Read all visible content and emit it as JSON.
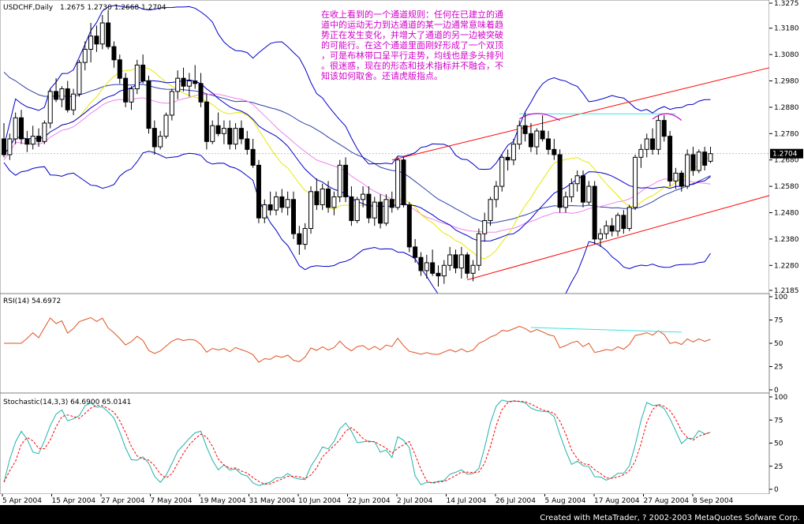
{
  "chart_data": {
    "type": "candlestick",
    "symbol_label": "USDCHF,Daily",
    "ohlc_label": "1.2675 1.2730 1.2668 1.2704",
    "current_price": "1.2704",
    "price_axis": {
      "range": [
        1.2185,
        1.3275
      ],
      "ticks": [
        "1.3275",
        "1.3180",
        "1.3080",
        "1.2980",
        "1.2880",
        "1.2780",
        "1.2680",
        "1.2580",
        "1.2480",
        "1.2380",
        "1.2280",
        "1.2185"
      ]
    },
    "x_axis": {
      "ticks": [
        "5 Apr 2004",
        "15 Apr 2004",
        "27 Apr 2004",
        "7 May 2004",
        "19 May 2004",
        "31 May 2004",
        "10 Jun 2004",
        "22 Jun 2004",
        "2 Jul 2004",
        "14 Jul 2004",
        "26 Jul 2004",
        "5 Aug 2004",
        "17 Aug 2004",
        "27 Aug 2004",
        "8 Sep 2004"
      ]
    },
    "candles": [
      [
        1.276,
        1.282,
        1.269,
        1.27
      ],
      [
        1.27,
        1.278,
        1.268,
        1.276
      ],
      [
        1.276,
        1.286,
        1.274,
        1.284
      ],
      [
        1.284,
        1.287,
        1.274,
        1.276
      ],
      [
        1.276,
        1.279,
        1.271,
        1.274
      ],
      [
        1.274,
        1.281,
        1.272,
        1.277
      ],
      [
        1.277,
        1.28,
        1.273,
        1.275
      ],
      [
        1.275,
        1.283,
        1.274,
        1.282
      ],
      [
        1.282,
        1.295,
        1.28,
        1.294
      ],
      [
        1.294,
        1.299,
        1.29,
        1.291
      ],
      [
        1.291,
        1.296,
        1.288,
        1.295
      ],
      [
        1.295,
        1.298,
        1.286,
        1.287
      ],
      [
        1.287,
        1.295,
        1.285,
        1.293
      ],
      [
        1.293,
        1.306,
        1.292,
        1.305
      ],
      [
        1.305,
        1.313,
        1.302,
        1.31
      ],
      [
        1.31,
        1.32,
        1.305,
        1.315
      ],
      [
        1.315,
        1.319,
        1.309,
        1.312
      ],
      [
        1.312,
        1.323,
        1.31,
        1.32
      ],
      [
        1.32,
        1.325,
        1.31,
        1.311
      ],
      [
        1.311,
        1.313,
        1.303,
        1.306
      ],
      [
        1.306,
        1.308,
        1.297,
        1.299
      ],
      [
        1.299,
        1.301,
        1.288,
        1.29
      ],
      [
        1.29,
        1.296,
        1.287,
        1.295
      ],
      [
        1.295,
        1.306,
        1.293,
        1.304
      ],
      [
        1.304,
        1.308,
        1.297,
        1.298
      ],
      [
        1.298,
        1.3,
        1.278,
        1.28
      ],
      [
        1.28,
        1.283,
        1.27,
        1.273
      ],
      [
        1.273,
        1.279,
        1.272,
        1.277
      ],
      [
        1.277,
        1.286,
        1.276,
        1.285
      ],
      [
        1.285,
        1.295,
        1.283,
        1.294
      ],
      [
        1.294,
        1.302,
        1.291,
        1.299
      ],
      [
        1.299,
        1.303,
        1.294,
        1.296
      ],
      [
        1.296,
        1.301,
        1.292,
        1.298
      ],
      [
        1.298,
        1.304,
        1.295,
        1.297
      ],
      [
        1.297,
        1.301,
        1.288,
        1.29
      ],
      [
        1.29,
        1.293,
        1.272,
        1.275
      ],
      [
        1.275,
        1.283,
        1.274,
        1.281
      ],
      [
        1.281,
        1.286,
        1.277,
        1.278
      ],
      [
        1.278,
        1.283,
        1.274,
        1.28
      ],
      [
        1.28,
        1.283,
        1.272,
        1.274
      ],
      [
        1.274,
        1.282,
        1.272,
        1.28
      ],
      [
        1.28,
        1.283,
        1.274,
        1.276
      ],
      [
        1.276,
        1.279,
        1.27,
        1.272
      ],
      [
        1.272,
        1.276,
        1.265,
        1.266
      ],
      [
        1.266,
        1.268,
        1.244,
        1.246
      ],
      [
        1.246,
        1.253,
        1.244,
        1.251
      ],
      [
        1.251,
        1.256,
        1.247,
        1.249
      ],
      [
        1.249,
        1.256,
        1.247,
        1.254
      ],
      [
        1.254,
        1.257,
        1.248,
        1.25
      ],
      [
        1.25,
        1.256,
        1.247,
        1.253
      ],
      [
        1.253,
        1.256,
        1.238,
        1.24
      ],
      [
        1.24,
        1.243,
        1.232,
        1.236
      ],
      [
        1.236,
        1.244,
        1.234,
        1.242
      ],
      [
        1.242,
        1.258,
        1.24,
        1.256
      ],
      [
        1.256,
        1.261,
        1.249,
        1.251
      ],
      [
        1.251,
        1.259,
        1.249,
        1.257
      ],
      [
        1.257,
        1.26,
        1.248,
        1.25
      ],
      [
        1.25,
        1.256,
        1.247,
        1.254
      ],
      [
        1.254,
        1.268,
        1.252,
        1.266
      ],
      [
        1.266,
        1.269,
        1.252,
        1.254
      ],
      [
        1.254,
        1.258,
        1.243,
        1.245
      ],
      [
        1.245,
        1.254,
        1.244,
        1.253
      ],
      [
        1.253,
        1.258,
        1.25,
        1.255
      ],
      [
        1.255,
        1.258,
        1.244,
        1.246
      ],
      [
        1.246,
        1.254,
        1.243,
        1.252
      ],
      [
        1.252,
        1.255,
        1.242,
        1.244
      ],
      [
        1.244,
        1.255,
        1.243,
        1.253
      ],
      [
        1.253,
        1.256,
        1.248,
        1.25
      ],
      [
        1.25,
        1.269,
        1.249,
        1.268
      ],
      [
        1.268,
        1.269,
        1.25,
        1.251
      ],
      [
        1.251,
        1.252,
        1.233,
        1.235
      ],
      [
        1.235,
        1.238,
        1.229,
        1.231
      ],
      [
        1.231,
        1.233,
        1.224,
        1.226
      ],
      [
        1.226,
        1.232,
        1.223,
        1.229
      ],
      [
        1.229,
        1.234,
        1.224,
        1.225
      ],
      [
        1.225,
        1.228,
        1.22,
        1.224
      ],
      [
        1.224,
        1.23,
        1.221,
        1.228
      ],
      [
        1.228,
        1.235,
        1.226,
        1.232
      ],
      [
        1.232,
        1.234,
        1.225,
        1.227
      ],
      [
        1.227,
        1.235,
        1.223,
        1.232
      ],
      [
        1.232,
        1.233,
        1.223,
        1.225
      ],
      [
        1.225,
        1.23,
        1.222,
        1.228
      ],
      [
        1.228,
        1.242,
        1.226,
        1.24
      ],
      [
        1.24,
        1.248,
        1.237,
        1.245
      ],
      [
        1.245,
        1.254,
        1.243,
        1.253
      ],
      [
        1.253,
        1.26,
        1.25,
        1.258
      ],
      [
        1.258,
        1.27,
        1.256,
        1.269
      ],
      [
        1.269,
        1.272,
        1.264,
        1.268
      ],
      [
        1.268,
        1.276,
        1.266,
        1.274
      ],
      [
        1.274,
        1.283,
        1.272,
        1.281
      ],
      [
        1.281,
        1.286,
        1.275,
        1.278
      ],
      [
        1.278,
        1.282,
        1.271,
        1.273
      ],
      [
        1.273,
        1.28,
        1.27,
        1.279
      ],
      [
        1.279,
        1.285,
        1.275,
        1.276
      ],
      [
        1.276,
        1.279,
        1.27,
        1.272
      ],
      [
        1.272,
        1.276,
        1.268,
        1.27
      ],
      [
        1.27,
        1.272,
        1.248,
        1.25
      ],
      [
        1.25,
        1.256,
        1.248,
        1.254
      ],
      [
        1.254,
        1.261,
        1.252,
        1.259
      ],
      [
        1.259,
        1.264,
        1.256,
        1.262
      ],
      [
        1.262,
        1.264,
        1.25,
        1.252
      ],
      [
        1.252,
        1.26,
        1.251,
        1.258
      ],
      [
        1.258,
        1.26,
        1.236,
        1.238
      ],
      [
        1.238,
        1.242,
        1.235,
        1.24
      ],
      [
        1.24,
        1.245,
        1.238,
        1.243
      ],
      [
        1.243,
        1.246,
        1.239,
        1.241
      ],
      [
        1.241,
        1.248,
        1.239,
        1.247
      ],
      [
        1.247,
        1.249,
        1.24,
        1.242
      ],
      [
        1.242,
        1.251,
        1.241,
        1.25
      ],
      [
        1.25,
        1.27,
        1.249,
        1.269
      ],
      [
        1.269,
        1.274,
        1.265,
        1.272
      ],
      [
        1.272,
        1.278,
        1.269,
        1.276
      ],
      [
        1.276,
        1.28,
        1.27,
        1.272
      ],
      [
        1.272,
        1.285,
        1.27,
        1.283
      ],
      [
        1.283,
        1.285,
        1.275,
        1.277
      ],
      [
        1.277,
        1.279,
        1.258,
        1.26
      ],
      [
        1.26,
        1.265,
        1.257,
        1.263
      ],
      [
        1.263,
        1.264,
        1.256,
        1.258
      ],
      [
        1.258,
        1.272,
        1.257,
        1.27
      ],
      [
        1.27,
        1.273,
        1.262,
        1.264
      ],
      [
        1.264,
        1.272,
        1.263,
        1.271
      ],
      [
        1.271,
        1.273,
        1.264,
        1.266
      ],
      [
        1.2675,
        1.273,
        1.2668,
        1.2704
      ]
    ],
    "indicators": {
      "bollinger": "Bollinger Bands (blue)",
      "moving_averages": [
        "Yellow MA",
        "Violet MA",
        "Dark blue MA"
      ],
      "channel_lines": "Red upward channel",
      "double_top_marker": "Magenta arcs with cyan neckline"
    },
    "rsi": {
      "label": "RSI(14) 54.6972",
      "ticks": [
        "100",
        "75",
        "50",
        "25",
        "0"
      ]
    },
    "stochastic": {
      "label": "Stochastic(14,3,3) 64.6900 65.0141",
      "ticks": [
        "100",
        "75",
        "50",
        "25",
        "0"
      ]
    },
    "annotation": "在收上看到的一个通道规则：任何在已建立的通道中的运动无力到达通道的某一边通常意味着趋势正在发生变化，并增大了通道的另一边被突破的可能行。在这个通道里面刚好形成了一个双顶，可是布林带口呈平行走势，均线也是多头排列。很迷惑，现在的形态和技术指标并不融合，不知该如何取舍。还请虎版指点。",
    "colors": {
      "background": "#ffffff",
      "candle": "#000000",
      "bollinger": "#0000c8",
      "ma_yellow": "#e8e800",
      "ma_violet": "#ee82ee",
      "ma_blue": "#3040a8",
      "channel": "#ff0000",
      "rsi": "#e05020",
      "stoch_main": "#20b2aa",
      "stoch_signal": "#ff0000",
      "annotation": "#d000c8"
    }
  },
  "footer": "Created with MetaTrader, ? 2002-2003 MetaQuotes Sofware Corp."
}
